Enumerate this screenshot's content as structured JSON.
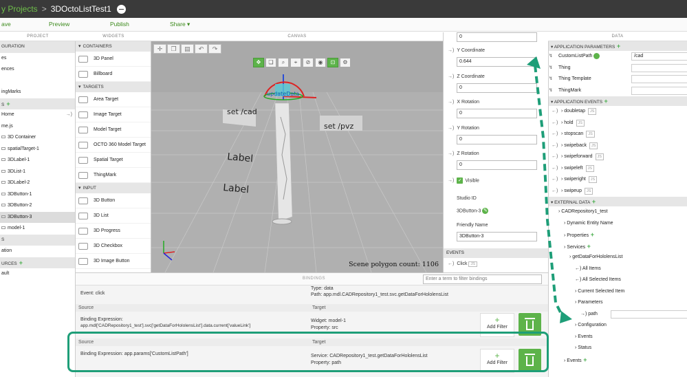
{
  "titlebar": {
    "breadcrumb": "y Projects",
    "separator": ">",
    "project_name": "3DOctoListTest1"
  },
  "actionbar": {
    "save": "ave",
    "preview": "Preview",
    "publish": "Publish",
    "share": "Share ▾"
  },
  "panel_headers": {
    "project": "PROJECT",
    "widgets": "WIDGETS",
    "canvas": "CANVAS",
    "data": "DATA"
  },
  "project": {
    "rows": [
      {
        "label": "GURATION",
        "section": true
      },
      {
        "label": "es"
      },
      {
        "label": "ences"
      },
      {
        "label": ""
      },
      {
        "label": "ingMarks"
      },
      {
        "label": "S",
        "section": true,
        "plus": true
      },
      {
        "label": "Home",
        "arrow": "→)"
      },
      {
        "label": "me.js"
      },
      {
        "label": "3D Container",
        "indent": true
      },
      {
        "label": "spatialTarget-1",
        "indent": true
      },
      {
        "label": "3DLabel-1",
        "indent": true
      },
      {
        "label": "3DList-1",
        "indent": true
      },
      {
        "label": "3DLabel-2",
        "indent": true
      },
      {
        "label": "3DButton-1",
        "indent": true
      },
      {
        "label": "3DButton-2",
        "indent": true
      },
      {
        "label": "3DButton-3",
        "indent": true,
        "selected": true
      },
      {
        "label": "model-1",
        "indent": true
      },
      {
        "label": "S",
        "section": true
      },
      {
        "label": "ation"
      },
      {
        "label": "URCES",
        "section": true,
        "plus": true
      },
      {
        "label": "ault"
      }
    ]
  },
  "widgets": {
    "groups": [
      {
        "category": "CONTAINERS",
        "items": [
          "3D Panel",
          "Billboard"
        ]
      },
      {
        "category": "TARGETS",
        "items": [
          "Area Target",
          "Image Target",
          "Model Target",
          "OCTO 360 Model Target",
          "Spatial Target",
          "ThingMark"
        ]
      },
      {
        "category": "INPUT",
        "items": [
          "3D Button",
          "3D List",
          "3D Progress",
          "3D Checkbox",
          "3D Image Button"
        ]
      }
    ]
  },
  "canvas": {
    "scene_count": "Scene polygon count: 1106",
    "labels": {
      "set_cad": "set /cad",
      "set_pvz": "set /pvz",
      "label1": "Label",
      "label2": "Label",
      "update_data": "updateData"
    }
  },
  "properties": {
    "top_value": "0",
    "y_label": "Y Coordinate",
    "y_value": "0.644",
    "z_label": "Z Coordinate",
    "z_value": "0",
    "xr_label": "X Rotation",
    "xr_value": "0",
    "yr_label": "Y Rotation",
    "yr_value": "0",
    "zr_label": "Z Rotation",
    "zr_value": "0",
    "visible_label": "Visible",
    "studio_id_label": "Studio ID",
    "studio_id_value": "3DButton-3",
    "friendly_label": "Friendly Name",
    "friendly_value": "3DButton-3",
    "events_header": "EVENTS",
    "click_event": "Click",
    "js": "JS"
  },
  "data": {
    "app_params_header": "APPLICATION PARAMETERS",
    "params": [
      {
        "name": "CustomListPath",
        "value": "/cad"
      },
      {
        "name": "Thing",
        "value": ""
      },
      {
        "name": "Thing Template",
        "value": ""
      },
      {
        "name": "ThingMark",
        "value": ""
      }
    ],
    "app_events_header": "APPLICATION EVENTS",
    "events": [
      "doubletap",
      "hold",
      "stopscan",
      "swipeback",
      "swipeforward",
      "swipeleft",
      "swiperight",
      "swipeup"
    ],
    "external_header": "EXTERNAL DATA",
    "tree": [
      {
        "label": "CADRepository1_test",
        "level": 1
      },
      {
        "label": "Dynamic Entity Name",
        "level": 2
      },
      {
        "label": "Properties",
        "level": 2
      },
      {
        "label": "Services",
        "level": 2
      },
      {
        "label": "getDataForHololensList",
        "level": 3
      },
      {
        "label": "All Items",
        "level": 4
      },
      {
        "label": "All Selected Items",
        "level": 4
      },
      {
        "label": "Current Selected Item",
        "level": 4
      },
      {
        "label": "Parameters",
        "level": 4
      },
      {
        "label": "path",
        "level": 5
      },
      {
        "label": "Configuration",
        "level": 4
      },
      {
        "label": "Events",
        "level": 4
      },
      {
        "label": "Status",
        "level": 4
      },
      {
        "label": "Events",
        "level": 2
      }
    ]
  },
  "bindings": {
    "title": "BINDINGS",
    "filter_placeholder": "Enter a term to filter bindings",
    "row0_event": "Event: click",
    "row0_type": "Type: data",
    "row0_path": "Path: app.mdl.CADRepository1_test.svc.getDataForHololensList",
    "source_label": "Source",
    "target_label": "Target",
    "row1_expr_label": "Binding Expression:",
    "row1_expr": "app.mdl['CADRepository1_test'].svc['getDataForHololensList'].data.current['valueLink']",
    "row1_widget": "Widget: model-1",
    "row1_prop": "Property: src",
    "row2_expr": "Binding Expression: app.params['CustomListPath']",
    "row2_service": "Service: CADRepository1_test.getDataForHololensList",
    "row2_prop": "Property: path",
    "add_filter": "Add Filter"
  },
  "colors": {
    "accent_green": "#5db34a",
    "highlight_teal": "#1e9e78",
    "titlebar": "#3a3a3a"
  }
}
